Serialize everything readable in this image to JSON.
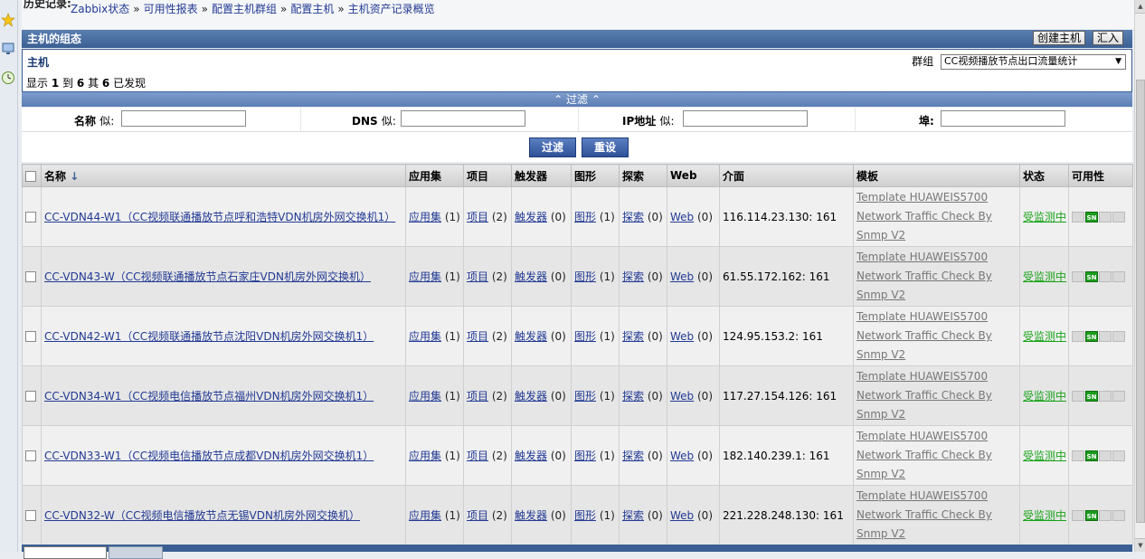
{
  "breadcrumb": {
    "history_label": "历史记录:",
    "items": [
      "Zabbix状态",
      "可用性报表",
      "配置主机群组",
      "配置主机",
      "主机资产记录概览"
    ],
    "sep": "»"
  },
  "header": {
    "title": "主机的组态",
    "create_button": "创建主机",
    "import_button": "汇入"
  },
  "hostbox": {
    "title": "主机",
    "group_label": "群组",
    "group_selected": "CC视频播放节点出口流量统计",
    "count_prefix": "显示",
    "count_from": "1",
    "count_to_word": "到",
    "count_to": "6",
    "count_of_word": "其",
    "count_total": "6",
    "count_suffix": "已发现"
  },
  "filter": {
    "bar_label": "过滤",
    "name_label": "名称",
    "name_like": "似:",
    "dns_label": "DNS",
    "dns_like": "似:",
    "ip_label": "IP地址",
    "ip_like": "似:",
    "port_label": "埠:",
    "filter_button": "过滤",
    "reset_button": "重设"
  },
  "table": {
    "headers": {
      "name": "名称",
      "apps": "应用集",
      "items": "项目",
      "triggers": "触发器",
      "graphs": "图形",
      "discovery": "探索",
      "web": "Web",
      "interface": "介面",
      "templates": "模板",
      "status": "状态",
      "availability": "可用性"
    },
    "rows": [
      {
        "name": "CC-VDN44-W1（CC视频联通播放节点呼和浩特VDN机房外网交换机1）",
        "apps": "应用集",
        "apps_n": "(1)",
        "items": "项目",
        "items_n": "(2)",
        "triggers": "触发器",
        "triggers_n": "(0)",
        "graphs": "图形",
        "graphs_n": "(1)",
        "discovery": "探索",
        "discovery_n": "(0)",
        "web": "Web",
        "web_n": "(0)",
        "interface": "116.114.23.130: 161",
        "template": "Template HUAWEIS5700 Network Traffic Check By Snmp V2",
        "status": "受监测中"
      },
      {
        "name": "CC-VDN43-W（CC视频联通播放节点石家庄VDN机房外网交换机）",
        "apps": "应用集",
        "apps_n": "(1)",
        "items": "项目",
        "items_n": "(2)",
        "triggers": "触发器",
        "triggers_n": "(0)",
        "graphs": "图形",
        "graphs_n": "(1)",
        "discovery": "探索",
        "discovery_n": "(0)",
        "web": "Web",
        "web_n": "(0)",
        "interface": "61.55.172.162: 161",
        "template": "Template HUAWEIS5700 Network Traffic Check By Snmp V2",
        "status": "受监测中"
      },
      {
        "name": "CC-VDN42-W1（CC视频联通播放节点沈阳VDN机房外网交换机1）",
        "apps": "应用集",
        "apps_n": "(1)",
        "items": "项目",
        "items_n": "(2)",
        "triggers": "触发器",
        "triggers_n": "(0)",
        "graphs": "图形",
        "graphs_n": "(1)",
        "discovery": "探索",
        "discovery_n": "(0)",
        "web": "Web",
        "web_n": "(0)",
        "interface": "124.95.153.2: 161",
        "template": "Template HUAWEIS5700 Network Traffic Check By Snmp V2",
        "status": "受监测中"
      },
      {
        "name": "CC-VDN34-W1（CC视频电信播放节点福州VDN机房外网交换机1）",
        "apps": "应用集",
        "apps_n": "(1)",
        "items": "项目",
        "items_n": "(2)",
        "triggers": "触发器",
        "triggers_n": "(0)",
        "graphs": "图形",
        "graphs_n": "(1)",
        "discovery": "探索",
        "discovery_n": "(0)",
        "web": "Web",
        "web_n": "(0)",
        "interface": "117.27.154.126: 161",
        "template": "Template HUAWEIS5700 Network Traffic Check By Snmp V2",
        "status": "受监测中"
      },
      {
        "name": "CC-VDN33-W1（CC视频电信播放节点成都VDN机房外网交换机1）",
        "apps": "应用集",
        "apps_n": "(1)",
        "items": "项目",
        "items_n": "(2)",
        "triggers": "触发器",
        "triggers_n": "(0)",
        "graphs": "图形",
        "graphs_n": "(1)",
        "discovery": "探索",
        "discovery_n": "(0)",
        "web": "Web",
        "web_n": "(0)",
        "interface": "182.140.239.1: 161",
        "template": "Template HUAWEIS5700 Network Traffic Check By Snmp V2",
        "status": "受监测中"
      },
      {
        "name": "CC-VDN32-W（CC视频电信播放节点无锡VDN机房外网交换机）",
        "apps": "应用集",
        "apps_n": "(1)",
        "items": "项目",
        "items_n": "(2)",
        "triggers": "触发器",
        "triggers_n": "(0)",
        "graphs": "图形",
        "graphs_n": "(1)",
        "discovery": "探索",
        "discovery_n": "(0)",
        "web": "Web",
        "web_n": "(0)",
        "interface": "221.228.248.130: 161",
        "template": "Template HUAWEIS5700 Network Traffic Check By Snmp V2",
        "status": "受监测中"
      }
    ],
    "availability_icons": [
      "ZBX",
      "SNMP",
      "JMX",
      "IPMI"
    ]
  },
  "colors": {
    "accent": "#3b5f93",
    "status_ok": "#19a319",
    "link": "#223a94"
  }
}
